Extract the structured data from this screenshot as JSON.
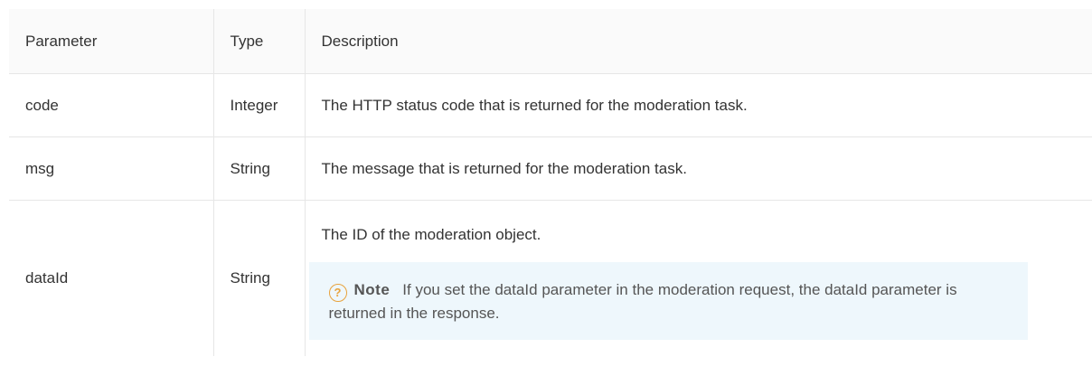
{
  "table": {
    "headers": [
      "Parameter",
      "Type",
      "Description"
    ],
    "rows": [
      {
        "parameter": "code",
        "type": "Integer",
        "description": "The HTTP status code that is returned for the moderation task."
      },
      {
        "parameter": "msg",
        "type": "String",
        "description": "The message that is returned for the moderation task."
      },
      {
        "parameter": "dataId",
        "type": "String",
        "description": "The ID of the moderation object."
      }
    ],
    "note": {
      "icon": "question-circle-icon",
      "label": "Note",
      "text": "If you set the dataId parameter in the moderation request, the dataId parameter is returned in the response."
    }
  },
  "colors": {
    "border": "#e6e6e6",
    "header_bg": "#fafafa",
    "note_bg": "#eef7fc",
    "note_icon": "#e8a33d"
  }
}
